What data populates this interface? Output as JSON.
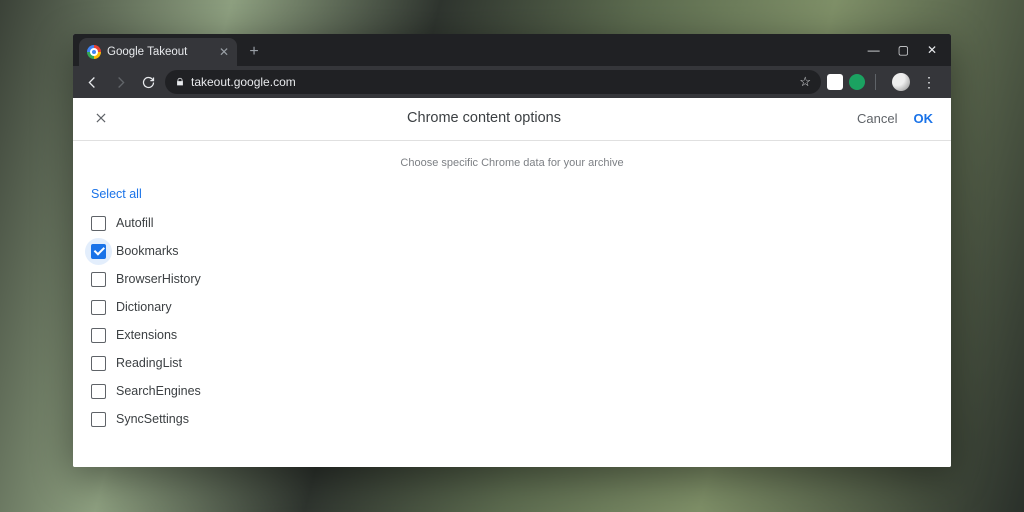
{
  "window": {
    "tab_title": "Google Takeout",
    "url_display": "takeout.google.com"
  },
  "dialog": {
    "title": "Chrome content options",
    "subtitle": "Choose specific Chrome data for your archive",
    "cancel_label": "Cancel",
    "ok_label": "OK",
    "select_all_label": "Select all",
    "items": [
      {
        "label": "Autofill",
        "checked": false
      },
      {
        "label": "Bookmarks",
        "checked": true
      },
      {
        "label": "BrowserHistory",
        "checked": false
      },
      {
        "label": "Dictionary",
        "checked": false
      },
      {
        "label": "Extensions",
        "checked": false
      },
      {
        "label": "ReadingList",
        "checked": false
      },
      {
        "label": "SearchEngines",
        "checked": false
      },
      {
        "label": "SyncSettings",
        "checked": false
      }
    ]
  }
}
